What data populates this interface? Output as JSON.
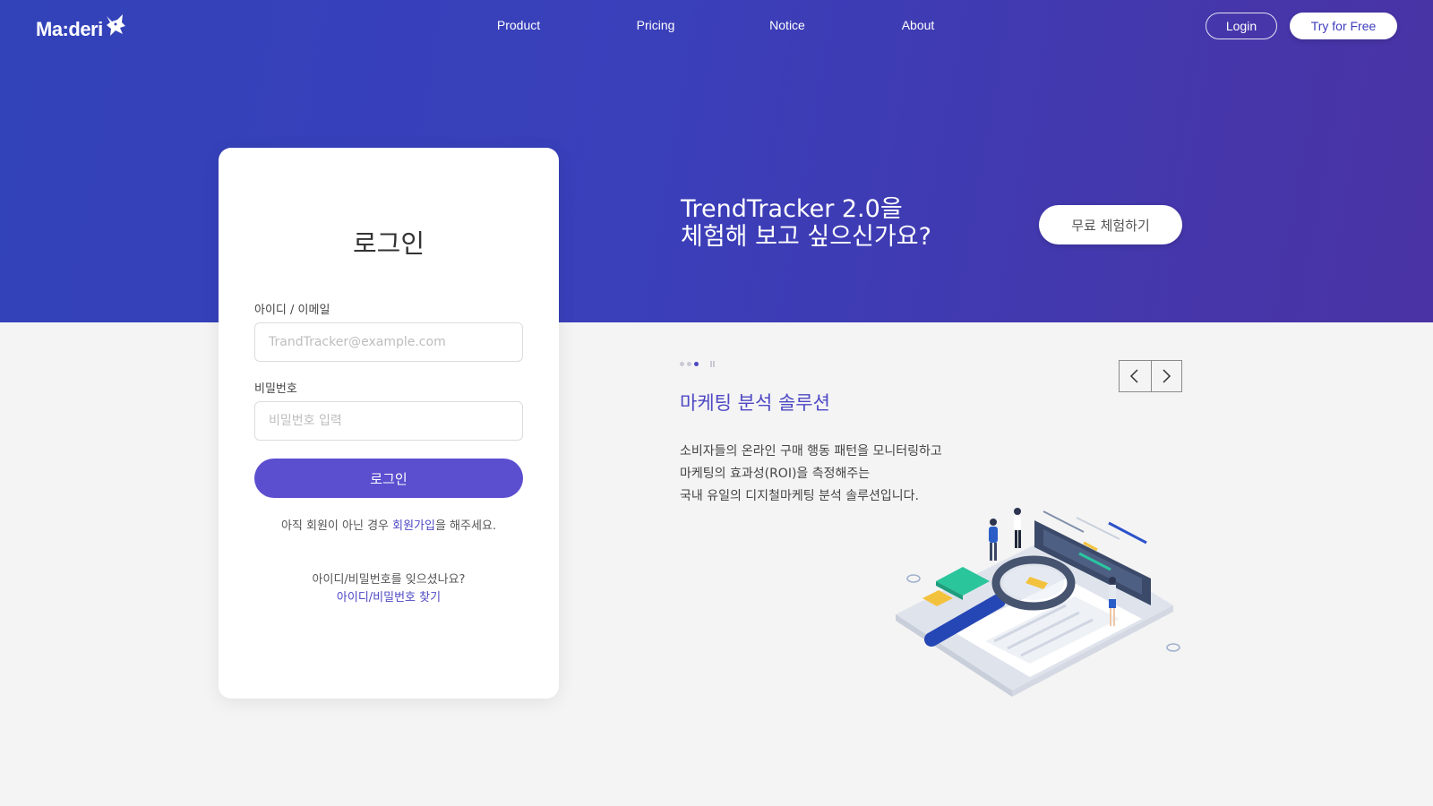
{
  "header": {
    "logo_text": "Ma:deri",
    "nav": [
      "Product",
      "Pricing",
      "Notice",
      "About"
    ],
    "login_label": "Login",
    "try_label": "Try for Free"
  },
  "hero": {
    "title_line1": "TrendTracker 2.0을",
    "title_line2": "체험해 보고 싶으신가요?",
    "cta_label": "무료 체험하기"
  },
  "login": {
    "title": "로그인",
    "id_label": "아이디 / 이메일",
    "id_placeholder": "TrandTracker@example.com",
    "pw_label": "비밀번호",
    "pw_placeholder": "비밀번호 입력",
    "submit_label": "로그인",
    "signup_prefix": "아직 회원이 아닌 경우 ",
    "signup_link": "회원가입",
    "signup_suffix": "을 해주세요.",
    "forgot_question": "아이디/비밀번호를 잊으셨나요?",
    "forgot_link": "아이디/비밀번호 찾기"
  },
  "feature": {
    "title": "마케팅 분석 솔루션",
    "desc_line1": "소비자들의 온라인 구매 행동 패턴을 모니터링하고",
    "desc_line2": "마케팅의 효과성(ROI)을 측정해주는",
    "desc_line3": "국내 유일의 디지철마케팅 분석 솔루션입니다.",
    "slide_count": 3,
    "active_slide": 3
  },
  "colors": {
    "hero_start": "#3242b9",
    "hero_end": "#4a33a4",
    "accent": "#5b4ecf",
    "link": "#4e48c4"
  },
  "icons": [
    "fox-logo-icon",
    "chevron-left-icon",
    "chevron-right-icon",
    "pause-icon",
    "magnifier-illustration"
  ]
}
